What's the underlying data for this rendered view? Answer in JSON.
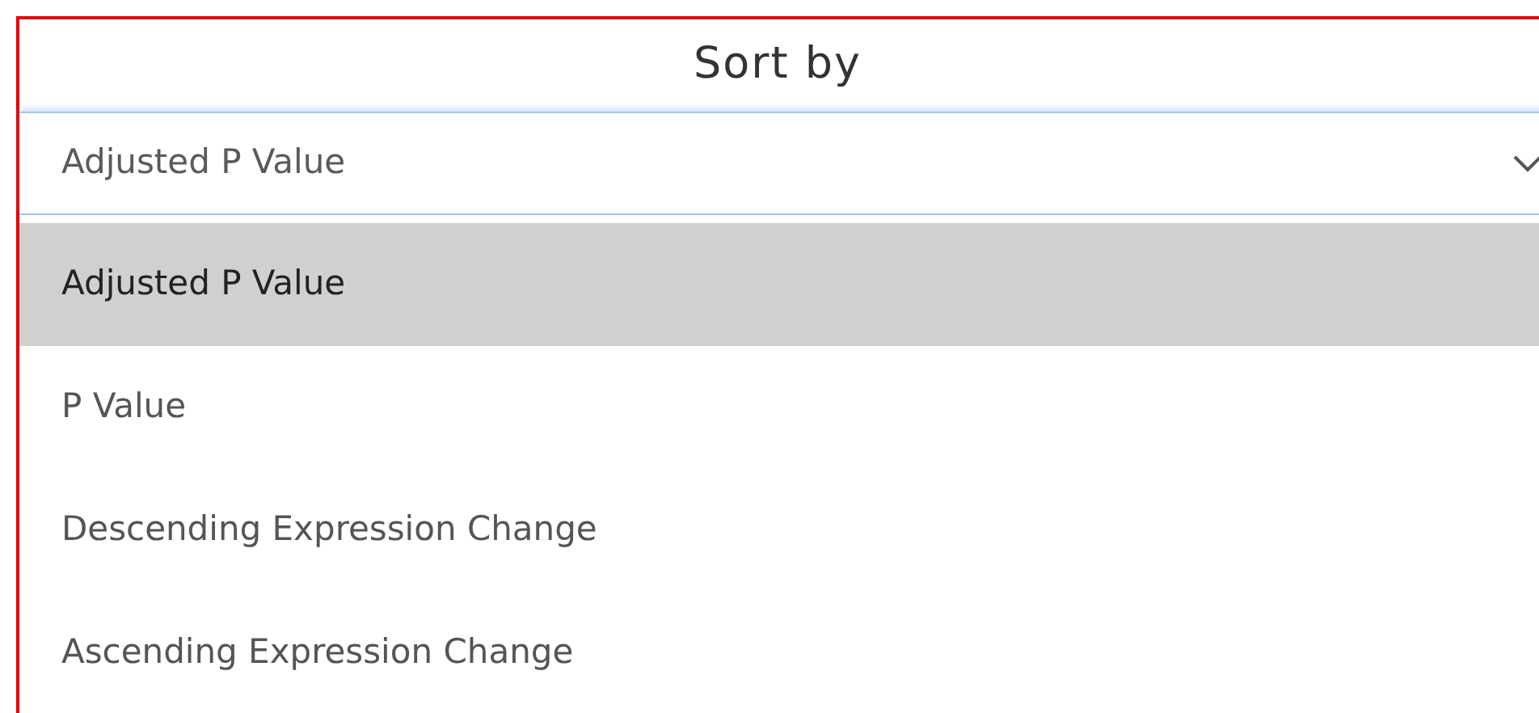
{
  "title": "Sort by",
  "select": {
    "value": "Adjusted P Value",
    "expanded": true
  },
  "options": [
    {
      "label": "Adjusted P Value",
      "selected": true
    },
    {
      "label": "P Value",
      "selected": false
    },
    {
      "label": "Descending Expression Change",
      "selected": false
    },
    {
      "label": "Ascending Expression Change",
      "selected": false
    }
  ]
}
